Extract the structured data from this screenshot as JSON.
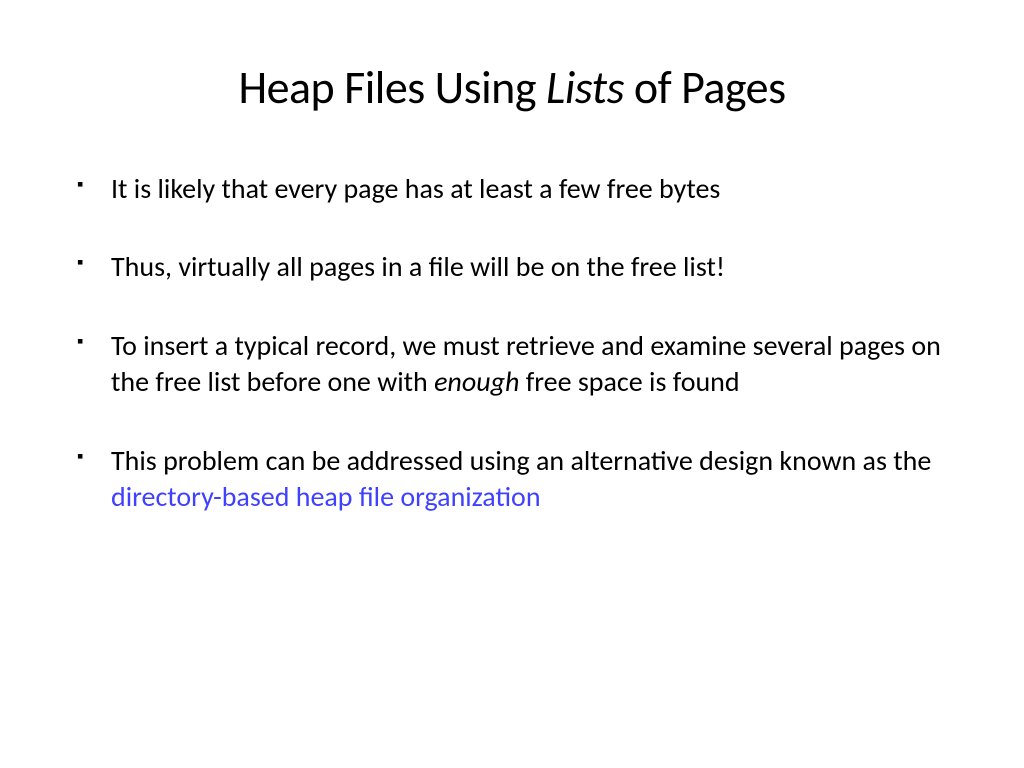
{
  "title": {
    "part1": "Heap Files Using ",
    "italic": "Lists",
    "part2": " of Pages"
  },
  "bullets": [
    {
      "text": "It is likely that every page has at least a few free bytes"
    },
    {
      "text": "Thus, virtually all pages in a file will be on the free list!"
    },
    {
      "prefix": "To insert a typical record, we must retrieve and examine several pages on the free list before one with ",
      "italic": "enough",
      "suffix": " free space is found"
    },
    {
      "prefix": "This problem can be addressed using an alternative design known as the ",
      "highlight": "directory-based heap file organization"
    }
  ]
}
